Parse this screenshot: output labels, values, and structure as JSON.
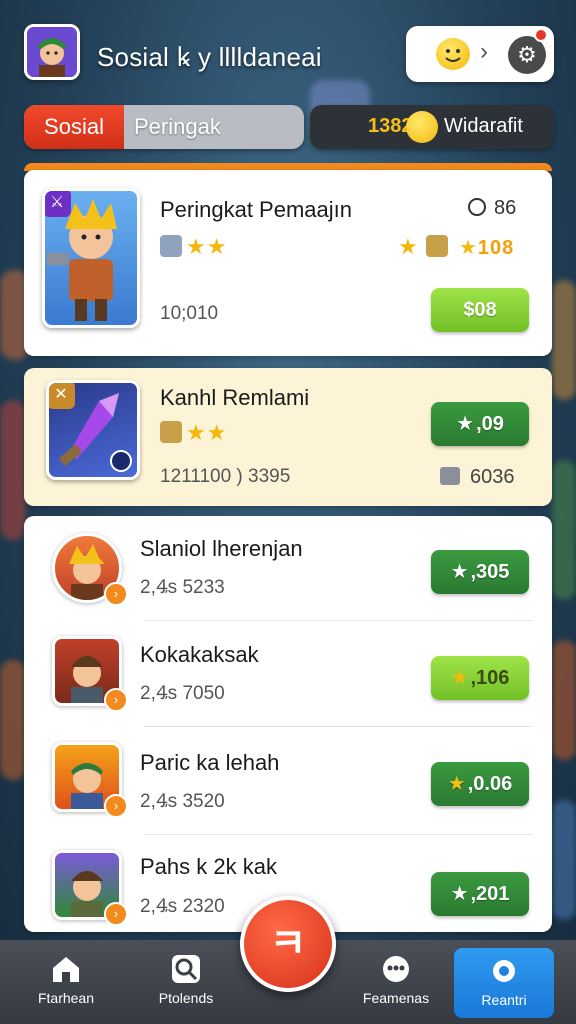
{
  "header": {
    "title": "Sosial ꝃ y lllldaneai",
    "avatar_icon": "hero-avatar-icon",
    "emoji_icon": "smiley-emoji-icon",
    "chevron": "›",
    "settings_icon": "gear-icon"
  },
  "tabs": {
    "active": "Sosial",
    "inactive": "Peringak"
  },
  "currency": {
    "value": "1382",
    "label": "Widarafit"
  },
  "featured": [
    {
      "name": "Peringkat Pemaajın",
      "score": "10;010",
      "timer": "86",
      "stars_left": "★★",
      "stars_right": "★",
      "right_value": "108",
      "button": "$08"
    },
    {
      "name": "Kanhl Remlami",
      "score": "1211100 ) 3395",
      "stars": "★★",
      "button": ",09",
      "right_value": "6036"
    }
  ],
  "rows": [
    {
      "name": "Slaniol lherenjan",
      "score": "2,Ꜯs 5233",
      "button": ",305"
    },
    {
      "name": "Kokakaksak",
      "score": "2,Ꜯs 7050",
      "button": ",106"
    },
    {
      "name": "Paric ka lehah",
      "score": "2,Ꜯs 3520",
      "button": ",0.06"
    },
    {
      "name": "Pahs k 2k kak",
      "score": "2,Ꜯs 2320",
      "button": ",201"
    }
  ],
  "nav": {
    "home": "Ftarhean",
    "search": "Ptolends",
    "fab_symbol": "ㅋ",
    "community": "Feamenas",
    "settings": "Reantri"
  },
  "colors": {
    "accent_red": "#d7311a",
    "accent_orange": "#f28a1e",
    "button_green_light": "#8fd63b",
    "button_green_dark": "#2f8a35",
    "nav_active_blue": "#2289e6"
  }
}
